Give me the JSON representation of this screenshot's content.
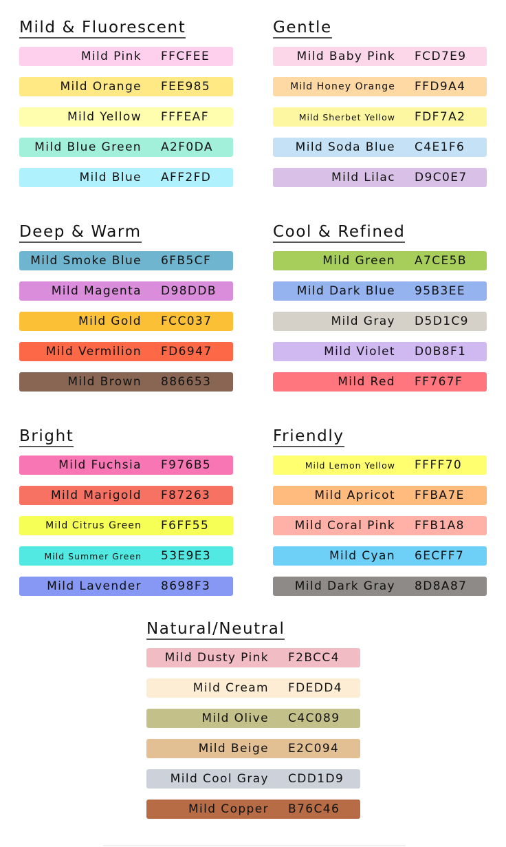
{
  "groups": [
    {
      "id": "mild",
      "title": "Mild & Fluorescent",
      "swatches": [
        {
          "name": "Mild Pink",
          "hex": "FFCFEE",
          "color": "#FFCFEE"
        },
        {
          "name": "Mild Orange",
          "hex": "FEE985",
          "color": "#FEE985"
        },
        {
          "name": "Mild Yellow",
          "hex": "FFFEAF",
          "color": "#FFFEAF"
        },
        {
          "name": "Mild Blue Green",
          "hex": "A2F0DA",
          "color": "#A2F0DA"
        },
        {
          "name": "Mild Blue",
          "hex": "AFF2FD",
          "color": "#AFF2FD"
        }
      ]
    },
    {
      "id": "gentle",
      "title": "Gentle",
      "swatches": [
        {
          "name": "Mild Baby Pink",
          "hex": "FCD7E9",
          "color": "#FCD7E9"
        },
        {
          "name": "Mild Honey Orange",
          "hex": "FFD9A4",
          "color": "#FFD9A4"
        },
        {
          "name": "Mild Sherbet Yellow",
          "hex": "FDF7A2",
          "color": "#FDF7A2"
        },
        {
          "name": "Mild Soda Blue",
          "hex": "C4E1F6",
          "color": "#C4E1F6"
        },
        {
          "name": "Mild Lilac",
          "hex": "D9C0E7",
          "color": "#D9C0E7"
        }
      ]
    },
    {
      "id": "deep",
      "title": "Deep & Warm",
      "swatches": [
        {
          "name": "Mild Smoke Blue",
          "hex": "6FB5CF",
          "color": "#6FB5CF"
        },
        {
          "name": "Mild Magenta",
          "hex": "D98DDB",
          "color": "#D98DDB"
        },
        {
          "name": "Mild Gold",
          "hex": "FCC037",
          "color": "#FCC037"
        },
        {
          "name": "Mild Vermilion",
          "hex": "FD6947",
          "color": "#FD6947"
        },
        {
          "name": "Mild Brown",
          "hex": "886653",
          "color": "#886653"
        }
      ]
    },
    {
      "id": "cool",
      "title": "Cool & Refined",
      "swatches": [
        {
          "name": "Mild Green",
          "hex": "A7CE5B",
          "color": "#A7CE5B"
        },
        {
          "name": "Mild Dark Blue",
          "hex": "95B3EE",
          "color": "#95B3EE"
        },
        {
          "name": "Mild Gray",
          "hex": "D5D1C9",
          "color": "#D5D1C9"
        },
        {
          "name": "Mild Violet",
          "hex": "D0B8F1",
          "color": "#D0B8F1"
        },
        {
          "name": "Mild Red",
          "hex": "FF767F",
          "color": "#FF767F"
        }
      ]
    },
    {
      "id": "bright",
      "title": "Bright",
      "swatches": [
        {
          "name": "Mild Fuchsia",
          "hex": "F976B5",
          "color": "#F976B5"
        },
        {
          "name": "Mild Marigold",
          "hex": "F87263",
          "color": "#F87263"
        },
        {
          "name": "Mild Citrus Green",
          "hex": "F6FF55",
          "color": "#F6FF55"
        },
        {
          "name": "Mild Summer Green",
          "hex": "53E9E3",
          "color": "#53E9E3"
        },
        {
          "name": "Mild Lavender",
          "hex": "8698F3",
          "color": "#8698F3"
        }
      ]
    },
    {
      "id": "friendly",
      "title": "Friendly",
      "swatches": [
        {
          "name": "Mild Lemon Yellow",
          "hex": "FFFF70",
          "color": "#FFFF70"
        },
        {
          "name": "Mild Apricot",
          "hex": "FFBA7E",
          "color": "#FFBA7E"
        },
        {
          "name": "Mild Coral Pink",
          "hex": "FFB1A8",
          "color": "#FFB1A8"
        },
        {
          "name": "Mild Cyan",
          "hex": "6ECFF7",
          "color": "#6ECFF7"
        },
        {
          "name": "Mild Dark Gray",
          "hex": "8D8A87",
          "color": "#8D8A87"
        }
      ]
    },
    {
      "id": "natural",
      "title": "Natural/Neutral",
      "swatches": [
        {
          "name": "Mild Dusty Pink",
          "hex": "F2BCC4",
          "color": "#F2BCC4"
        },
        {
          "name": "Mild Cream",
          "hex": "FDEDD4",
          "color": "#FDEDD4"
        },
        {
          "name": "Mild Olive",
          "hex": "C4C089",
          "color": "#C4C089"
        },
        {
          "name": "Mild Beige",
          "hex": "E2C094",
          "color": "#E2C094"
        },
        {
          "name": "Mild Cool Gray",
          "hex": "CDD1D9",
          "color": "#CDD1D9"
        },
        {
          "name": "Mild Copper",
          "hex": "B76C46",
          "color": "#B76C46"
        }
      ]
    }
  ]
}
